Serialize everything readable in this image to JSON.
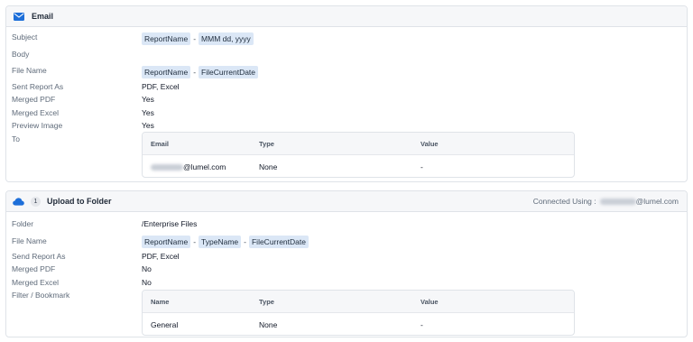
{
  "email": {
    "title": "Email",
    "fields": {
      "subject_label": "Subject",
      "subject_chips": [
        "ReportName",
        "MMM dd, yyyy"
      ],
      "body_label": "Body",
      "file_name_label": "File Name",
      "file_name_chips": [
        "ReportName",
        "FileCurrentDate"
      ],
      "sent_report_label": "Sent Report As",
      "sent_report_value": "PDF, Excel",
      "merged_pdf_label": "Merged PDF",
      "merged_pdf_value": "Yes",
      "merged_excel_label": "Merged Excel",
      "merged_excel_value": "Yes",
      "preview_image_label": "Preview Image",
      "preview_image_value": "Yes",
      "to_label": "To"
    },
    "table": {
      "headers": [
        "Email",
        "Type",
        "Value"
      ],
      "rows": [
        {
          "email_suffix": "@lumel.com",
          "type": "None",
          "value": "-"
        }
      ]
    }
  },
  "upload": {
    "step": "1",
    "title": "Upload to Folder",
    "connected_prefix": "Connected Using :",
    "connected_suffix": "@lumel.com",
    "fields": {
      "folder_label": "Folder",
      "folder_value": "/Enterprise Files",
      "file_name_label": "File Name",
      "file_name_chips": [
        "ReportName",
        "TypeName",
        "FileCurrentDate"
      ],
      "send_report_label": "Send Report As",
      "send_report_value": "PDF, Excel",
      "merged_pdf_label": "Merged PDF",
      "merged_pdf_value": "No",
      "merged_excel_label": "Merged Excel",
      "merged_excel_value": "No",
      "filter_label": "Filter / Bookmark"
    },
    "table": {
      "headers": [
        "Name",
        "Type",
        "Value"
      ],
      "rows": [
        {
          "name": "General",
          "type": "None",
          "value": "-"
        }
      ]
    }
  },
  "colors": {
    "accent": "#1e6fd9",
    "chip_bg": "#dbe7f6"
  },
  "icons": {
    "email": "mail-icon",
    "upload": "cloud-icon"
  }
}
